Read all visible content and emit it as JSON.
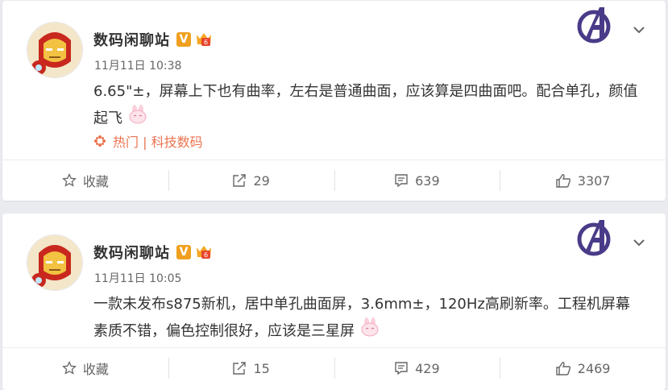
{
  "posts": [
    {
      "author": "数码闲聊站",
      "verified_badge": "V",
      "time": "11月11日 10:38",
      "content": "6.65\"±，屏幕上下也有曲率，左右是普通曲面，应该算是四曲面吧。配合单孔，颜值起飞",
      "topic": "热门 | 科技数码",
      "actions": {
        "favorite": "收藏",
        "repost": "29",
        "comment": "639",
        "like": "3307"
      }
    },
    {
      "author": "数码闲聊站",
      "verified_badge": "V",
      "time": "11月11日 10:05",
      "content": "一款未发布s875新机，居中单孔曲面屏，3.6mm±，120Hz高刷新率。工程机屏幕素质不错，偏色控制很好，应该是三星屏",
      "actions": {
        "favorite": "收藏",
        "repost": "15",
        "comment": "429",
        "like": "2469"
      }
    }
  ],
  "colors": {
    "topic": "#eb7350",
    "badge": "#f0a020",
    "background": "#e9ebef"
  },
  "icons": [
    "avatar-ironman",
    "avengers-logo",
    "chevron-down-icon",
    "star-icon",
    "share-icon",
    "comment-icon",
    "thumbs-up-icon"
  ]
}
